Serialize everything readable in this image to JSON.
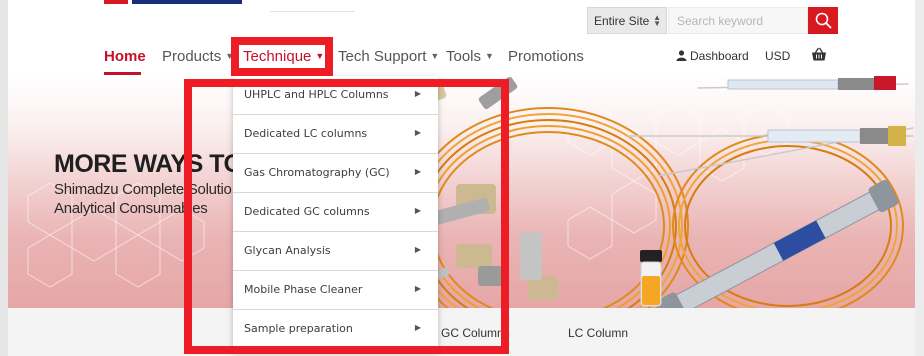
{
  "search": {
    "scope": "Entire Site",
    "placeholder": "Search keyword"
  },
  "nav": {
    "home": "Home",
    "products": "Products",
    "technique": "Technique",
    "tech_support": "Tech Support",
    "tools": "Tools",
    "promotions": "Promotions"
  },
  "utility": {
    "dashboard": "Dashboard",
    "currency": "USD"
  },
  "banner": {
    "headline": "MORE WAYS TO",
    "subline_1": "Shimadzu Complete Solutio",
    "subline_2": "Analytical Consumables"
  },
  "technique_menu": {
    "items": [
      "UHPLC and HPLC Columns",
      "Dedicated LC columns",
      "Gas Chromatography (GC)",
      "Dedicated GC columns",
      "Glycan Analysis",
      "Mobile Phase Cleaner",
      "Sample preparation"
    ]
  },
  "category_strip": {
    "gc_columns": "GC Columns",
    "lc_column": "LC Column"
  },
  "colors": {
    "brand_red": "#c8102e",
    "annotation_red": "#ee1c25",
    "search_red": "#d71920",
    "logo_blue": "#1a2f7a"
  }
}
